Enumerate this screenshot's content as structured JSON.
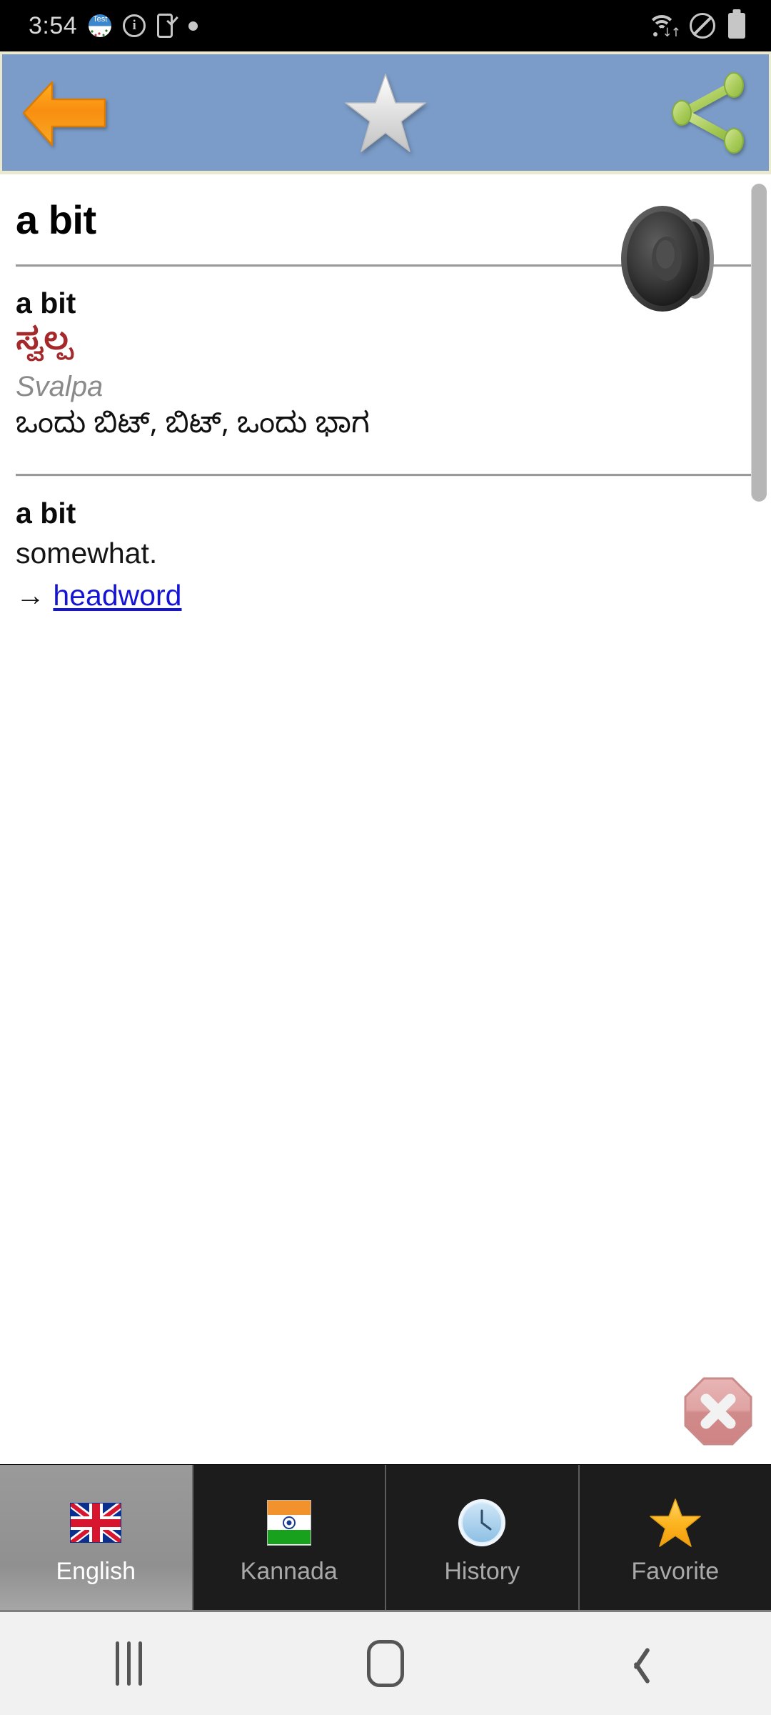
{
  "status_bar": {
    "time": "3:54",
    "left_icons": [
      {
        "name": "test-app-icon",
        "label": "Test"
      },
      {
        "name": "info-circle-icon",
        "label": "i"
      },
      {
        "name": "phone-check-icon",
        "label": ""
      },
      {
        "name": "notification-dot-icon",
        "label": ""
      }
    ],
    "right_icons": [
      {
        "name": "wifi-icon",
        "label": ""
      },
      {
        "name": "do-not-disturb-icon",
        "label": ""
      },
      {
        "name": "battery-icon",
        "label": ""
      }
    ]
  },
  "toolbar": {
    "background_color": "#7b9cc8",
    "border_color": "#e9ead0",
    "back_label": "Back",
    "favorite_label": "Add to favorites",
    "share_label": "Share"
  },
  "content": {
    "headword": "a bit",
    "entry": {
      "en_word": "a bit",
      "kannada": "ಸ್ವಲ್ಪ",
      "kannada_color": "#a5282a",
      "transliteration": "Svalpa",
      "kannada_meanings": "ಒಂದು ಬಿಟ್, ಬಿಟ್, ಒಂದು ಭಾಗ"
    },
    "definition": {
      "word": "a bit",
      "gloss": "somewhat.",
      "see_also_arrow": "→",
      "see_also_link": "headword",
      "link_color": "#1414d6"
    },
    "speaker_label": "Pronounce",
    "close_label": "Close"
  },
  "tabbar": {
    "active_index": 0,
    "tabs": [
      {
        "label": "English",
        "icon": "uk-flag-icon"
      },
      {
        "label": "Kannada",
        "icon": "india-flag-icon"
      },
      {
        "label": "History",
        "icon": "clock-icon"
      },
      {
        "label": "Favorite",
        "icon": "gold-star-icon"
      }
    ]
  },
  "system_nav": {
    "recents_label": "Recents",
    "home_label": "Home",
    "back_label": "Back"
  }
}
